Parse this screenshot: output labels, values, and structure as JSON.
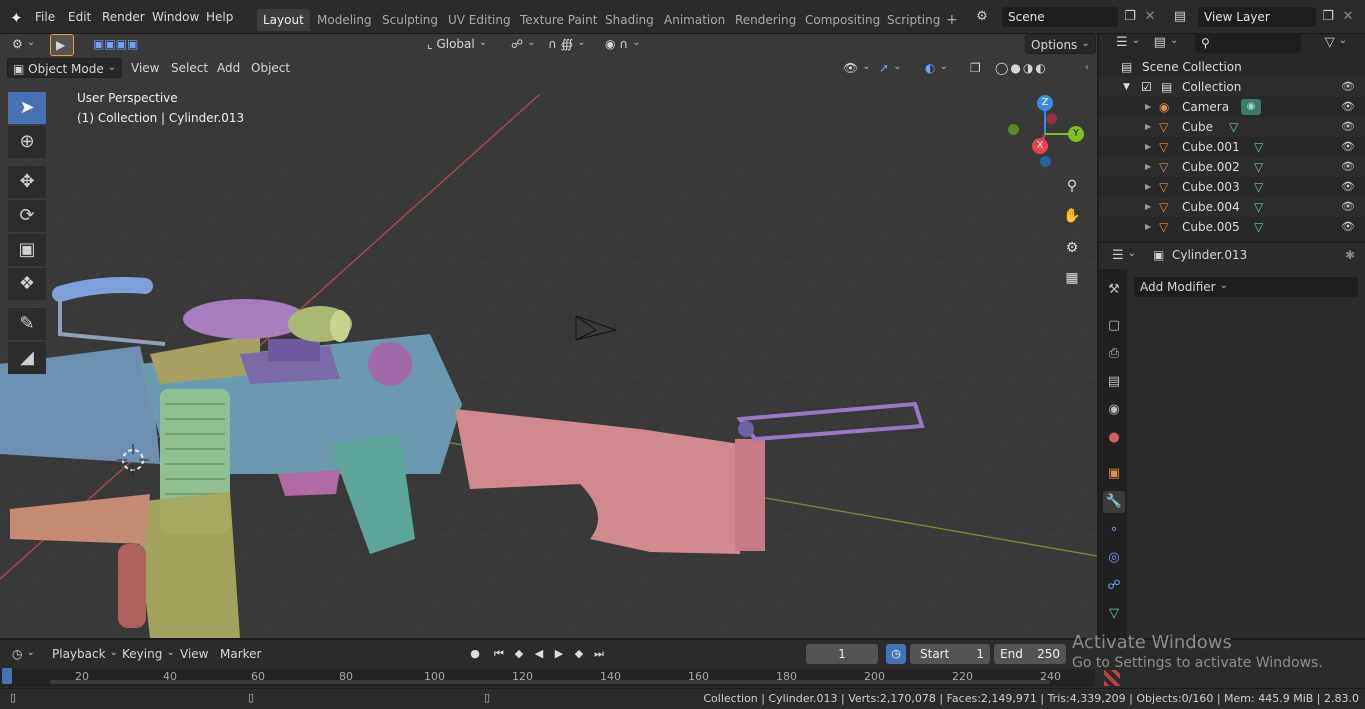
{
  "topbar": {
    "menu": [
      "File",
      "Edit",
      "Render",
      "Window",
      "Help"
    ],
    "workspaces": [
      {
        "label": "Layout",
        "active": true
      },
      {
        "label": "Modeling"
      },
      {
        "label": "Sculpting"
      },
      {
        "label": "UV Editing"
      },
      {
        "label": "Texture Paint"
      },
      {
        "label": "Shading"
      },
      {
        "label": "Animation"
      },
      {
        "label": "Rendering"
      },
      {
        "label": "Compositing"
      },
      {
        "label": "Scripting"
      }
    ],
    "add_workspace": "+",
    "scene": "Scene",
    "view_layer": "View Layer"
  },
  "viewport": {
    "transform_orientation": "Global",
    "options": "Options",
    "mode": "Object Mode",
    "header_menu": [
      "View",
      "Select",
      "Add",
      "Object"
    ],
    "view_name": "User Perspective",
    "object_info": "(1) Collection | Cylinder.013",
    "gizmo": {
      "x": "X",
      "y": "Y",
      "z": "Z"
    }
  },
  "outliner": {
    "root": "Scene Collection",
    "collection": "Collection",
    "items": [
      "Camera",
      "Cube",
      "Cube.001",
      "Cube.002",
      "Cube.003",
      "Cube.004",
      "Cube.005"
    ]
  },
  "properties": {
    "object": "Cylinder.013",
    "add_modifier": "Add Modifier"
  },
  "timeline": {
    "menu": [
      "Playback",
      "Keying",
      "View",
      "Marker"
    ],
    "current_frame": "1",
    "start_label": "Start",
    "start": "1",
    "end_label": "End",
    "end": "250",
    "ticks": [
      "20",
      "40",
      "60",
      "80",
      "100",
      "120",
      "140",
      "160",
      "180",
      "200",
      "220",
      "240"
    ]
  },
  "status": "Collection | Cylinder.013 | Verts:2,170,078 | Faces:2,149,971 | Tris:4,339,209 | Objects:0/160 | Mem: 445.9 MiB | 2.83.0",
  "watermark": {
    "title": "Activate Windows",
    "subtitle": "Go to Settings to activate Windows."
  },
  "colors": {
    "accent": "#4772b3",
    "viewport_bg": "#393939",
    "axis_x": "#e8414f",
    "axis_y": "#83c11f",
    "axis_z": "#3a8ce8"
  }
}
